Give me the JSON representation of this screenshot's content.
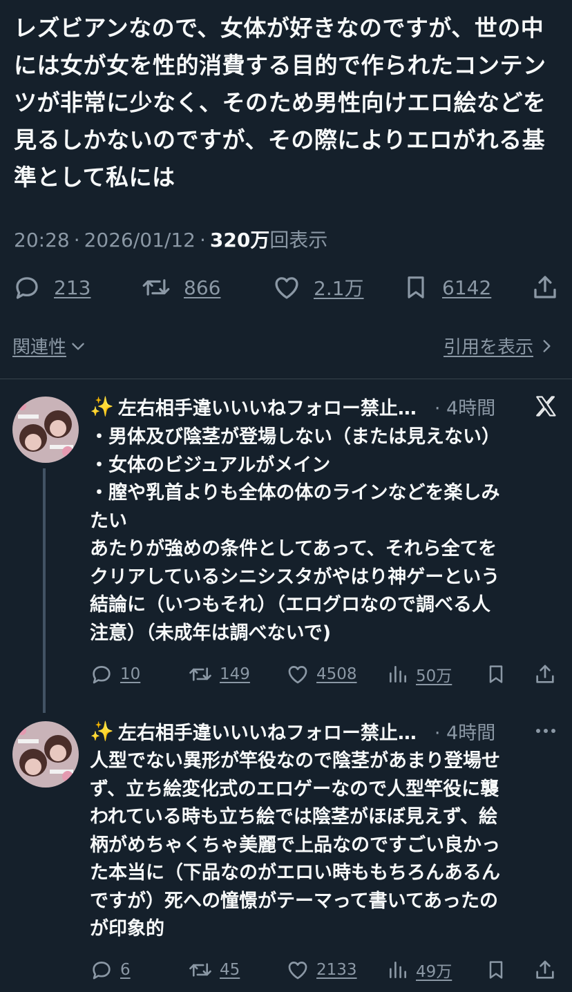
{
  "tweet": {
    "text": "レズビアンなので、女体が好きなのですが、世の中\nには女が女を性的消費する目的で作られたコンテン\nツが非常に少なく、そのため男性向けエロ絵などを\n見るしかないのですが、その際によりエロがれる基\n準として私には",
    "time": "20:28",
    "date": "2026/01/12",
    "views_number": "320万",
    "views_label": "回表示",
    "replies": "213",
    "reposts": "866",
    "likes": "2.1万",
    "bookmarks": "6142"
  },
  "links": {
    "related": "関連性",
    "quotes": "引用を表示"
  },
  "replies": [
    {
      "emoji": "✨",
      "name": "左右相手違いいいねフォロー禁止…",
      "time": "· 4時間",
      "text": "・男体及び陰茎が登場しない（または見えない）\n・女体のビジュアルがメイン\n・膣や乳首よりも全体の体のラインなどを楽しみ\nたい\nあたりが強めの条件としてあって、それら全てを\nクリアしているシニシスタがやはり神ゲーという\n結論に（いつもそれ）（エログロなので調べる人\n注意）（未成年は調べないで)",
      "replies": "10",
      "reposts": "149",
      "likes": "4508",
      "views": "50万"
    },
    {
      "emoji": "✨",
      "name": "左右相手違いいいねフォロー禁止…",
      "time": "· 4時間",
      "text": "人型でない異形が竿役なので陰茎があまり登場せ\nず、立ち絵変化式のエロゲーなので人型竿役に襲\nわれている時も立ち絵では陰茎がほぼ見えず、絵\n柄がめちゃくちゃ美麗で上品なのですごい良かっ\nた本当に（下品なのがエロい時ももちろんあるん\nですが）死への憧憬がテーマって書いてあったの\nが印象的",
      "replies": "6",
      "reposts": "45",
      "likes": "2133",
      "views": "49万"
    }
  ],
  "colors": {
    "background": "#15202b",
    "text": "#f7f9f9",
    "muted": "#8b98a5",
    "divider": "#38444d"
  },
  "icons": [
    "reply-icon",
    "repost-icon",
    "like-icon",
    "bookmark-icon",
    "share-icon",
    "views-icon",
    "chevron-down-icon",
    "chevron-right-icon",
    "x-logo-icon",
    "more-icon",
    "sparkles-icon"
  ]
}
